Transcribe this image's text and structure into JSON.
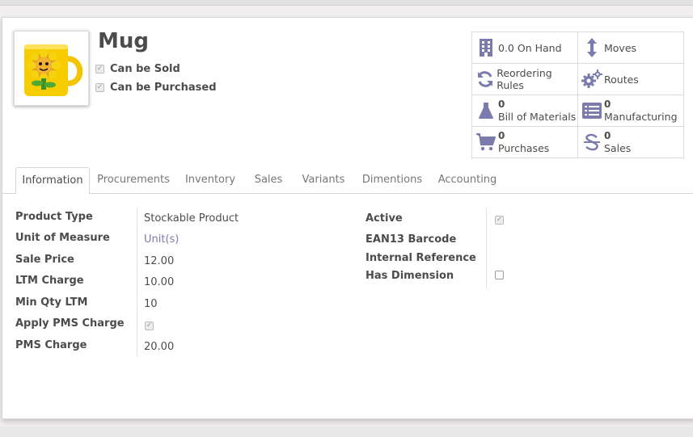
{
  "product": {
    "name": "Mug",
    "can_be_sold_label": "Can be Sold",
    "can_be_purchased_label": "Can be Purchased"
  },
  "smart_buttons": [
    {
      "icon": "building-icon",
      "number": "",
      "label": "0.0 On Hand"
    },
    {
      "icon": "up-down-arrows-icon",
      "number": "",
      "label": "Moves"
    },
    {
      "icon": "refresh-icon",
      "number": "",
      "label": "Reordering Rules"
    },
    {
      "icon": "cogs-icon",
      "number": "",
      "label": "Routes"
    },
    {
      "icon": "flask-icon",
      "number": "0",
      "label": "Bill of Materials"
    },
    {
      "icon": "list-alt-icon",
      "number": "0",
      "label": "Manufacturing"
    },
    {
      "icon": "shopping-cart-icon",
      "number": "0",
      "label": "Purchases"
    },
    {
      "icon": "strikethrough-icon",
      "number": "0",
      "label": "Sales"
    }
  ],
  "tabs": [
    "Information",
    "Procurements",
    "Inventory",
    "Sales",
    "Variants",
    "Dimentions",
    "Accounting"
  ],
  "active_tab": "Information",
  "left_fields": [
    {
      "label": "Product Type",
      "value": "Stockable Product"
    },
    {
      "label": "Unit of Measure",
      "value": "Unit(s)"
    },
    {
      "label": "Sale Price",
      "value": "12.00"
    },
    {
      "label": "LTM Charge",
      "value": "10.00"
    },
    {
      "label": "Min Qty LTM",
      "value": "10"
    },
    {
      "label": "Apply PMS Charge",
      "value": "checked"
    },
    {
      "label": "PMS Charge",
      "value": "20.00"
    }
  ],
  "right_fields": [
    {
      "label": "Active",
      "value": "checked"
    },
    {
      "label": "EAN13 Barcode",
      "value": ""
    },
    {
      "label": "Internal Reference",
      "value": ""
    },
    {
      "label": "Has Dimension",
      "value": "unchecked"
    }
  ],
  "colors": {
    "accent": "#7c7bad",
    "text": "#4c4c4c"
  }
}
